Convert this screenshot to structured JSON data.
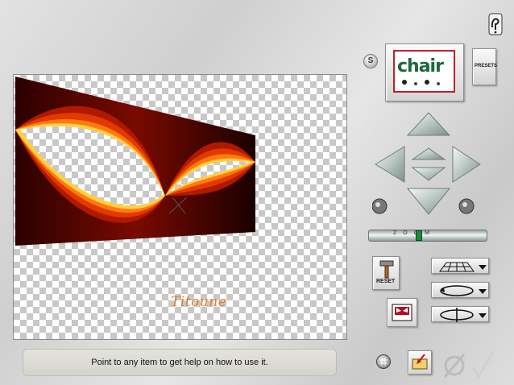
{
  "preview": {
    "signature": "Titoune"
  },
  "status": {
    "help_text": "Point to any item to get help on how to use it."
  },
  "presets": {
    "thumb_text": "chair",
    "button_label": "PRESETS",
    "s_label": "S"
  },
  "slider": {
    "label": "ZOOM",
    "value_fraction": 0.42
  },
  "reset": {
    "label": "RESET"
  },
  "colors": {
    "flame_outer": "#5a0000",
    "flame_mid": "#e03a00",
    "flame_inner": "#ffd040",
    "accent_red": "#c0202a",
    "slider_thumb": "#1d8a3a"
  },
  "icons": [
    "help-icon",
    "s-button-icon",
    "arrow-up-icon",
    "arrow-down-icon",
    "arrow-left-icon",
    "arrow-right-icon",
    "center-up-icon",
    "center-down-icon",
    "rotate-left-icon",
    "rotate-right-icon",
    "grid-plane-icon",
    "ellipse-loop-icon",
    "rotate-loop-icon",
    "hammer-icon",
    "mask-icon",
    "grid-icon",
    "import-icon",
    "cancel-icon",
    "ok-check-icon"
  ]
}
